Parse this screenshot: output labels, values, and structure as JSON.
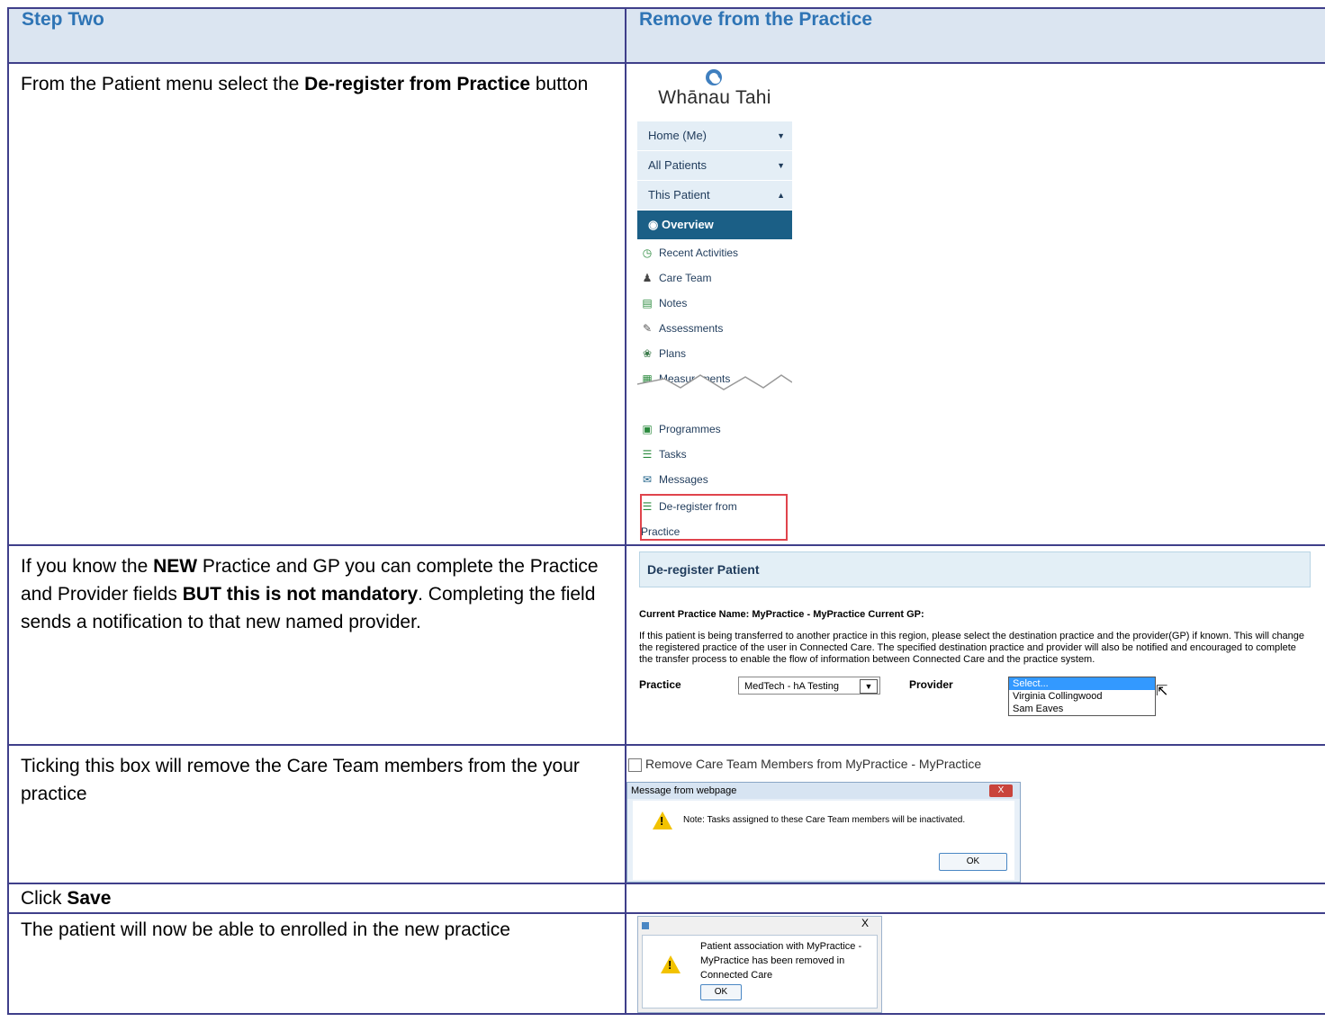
{
  "header": {
    "left": "Step Two",
    "right": "Remove from the Practice"
  },
  "rows": {
    "r1": {
      "text_pre": "From the Patient menu  select the ",
      "text_bold": "De-register from Practice",
      "text_post": " button"
    },
    "r2": {
      "t1": "If you know the ",
      "b1": "NEW",
      "t2": " Practice and GP you can complete the Practice and Provider fields ",
      "b2": "BUT this is not mandatory",
      "t3": ". Completing the field sends a notification to that new named provider."
    },
    "r3": {
      "text": "Ticking this box will remove the Care Team members from the your practice"
    },
    "r4": {
      "text_pre": "Click ",
      "text_bold": "Save"
    },
    "r5": {
      "text": "The patient will now be able to  enrolled in the new practice"
    }
  },
  "menu": {
    "logo": "Whānau Tahi",
    "items": [
      {
        "label": "Home (Me)",
        "arrow": "▼"
      },
      {
        "label": "All Patients",
        "arrow": "▼"
      },
      {
        "label": "This Patient",
        "arrow": "▲"
      }
    ],
    "selected": "Overview",
    "sub": [
      {
        "label": "Recent Activities",
        "icon": "clock-icon",
        "glyph": "◷",
        "color": "#2b8a3e"
      },
      {
        "label": "Care Team",
        "icon": "people-icon",
        "glyph": "♟",
        "color": "#444"
      },
      {
        "label": "Notes",
        "icon": "notes-icon",
        "glyph": "▤",
        "color": "#2b8a3e"
      },
      {
        "label": "Assessments",
        "icon": "assessment-icon",
        "glyph": "✎",
        "color": "#555"
      },
      {
        "label": "Plans",
        "icon": "plans-icon",
        "glyph": "❀",
        "color": "#3a7a4a"
      },
      {
        "label": "Measurements",
        "icon": "measurements-icon",
        "glyph": "▦",
        "color": "#2b8a3e"
      }
    ],
    "sub2": [
      {
        "label": "Programmes",
        "icon": "programmes-icon",
        "glyph": "▣",
        "color": "#2b8a3e"
      },
      {
        "label": "Tasks",
        "icon": "tasks-icon",
        "glyph": "☰",
        "color": "#2b8a3e"
      },
      {
        "label": "Messages",
        "icon": "messages-icon",
        "glyph": "✉",
        "color": "#1b5f86"
      }
    ],
    "dereg_line1": "De-register from",
    "dereg_line2": "Practice"
  },
  "panel": {
    "title": "De-register Patient",
    "current": "Current Practice Name: MyPractice - MyPractice Current GP:",
    "desc": "If this patient is being transferred to another practice in this region, please select the destination practice and the provider(GP) if known. This will change the registered practice of the user in Connected Care. The specified destination practice and provider will also be notified and encouraged to complete the transfer process to enable the flow of information between Connected Care and the practice system.",
    "practice_label": "Practice",
    "practice_value": "MedTech - hA Testing",
    "provider_label": "Provider",
    "provider_options": [
      "Select...",
      "Virginia Collingwood",
      "Sam Eaves"
    ]
  },
  "checkbox_label": "Remove Care Team Members from MyPractice - MyPractice",
  "dialog1": {
    "title": "Message from webpage",
    "close": "X",
    "message": "Note: Tasks assigned to these Care Team members will be inactivated.",
    "ok": "OK"
  },
  "dialog2": {
    "close": "X",
    "message": "Patient association with MyPractice - MyPractice has been removed in Connected Care",
    "ok": "OK"
  },
  "colors": {
    "heading": "#2e74b5",
    "header_bg": "#dbe5f1",
    "border": "#3f3f8a",
    "highlight_box": "#e0444c",
    "menu_selected": "#1b5f86"
  }
}
